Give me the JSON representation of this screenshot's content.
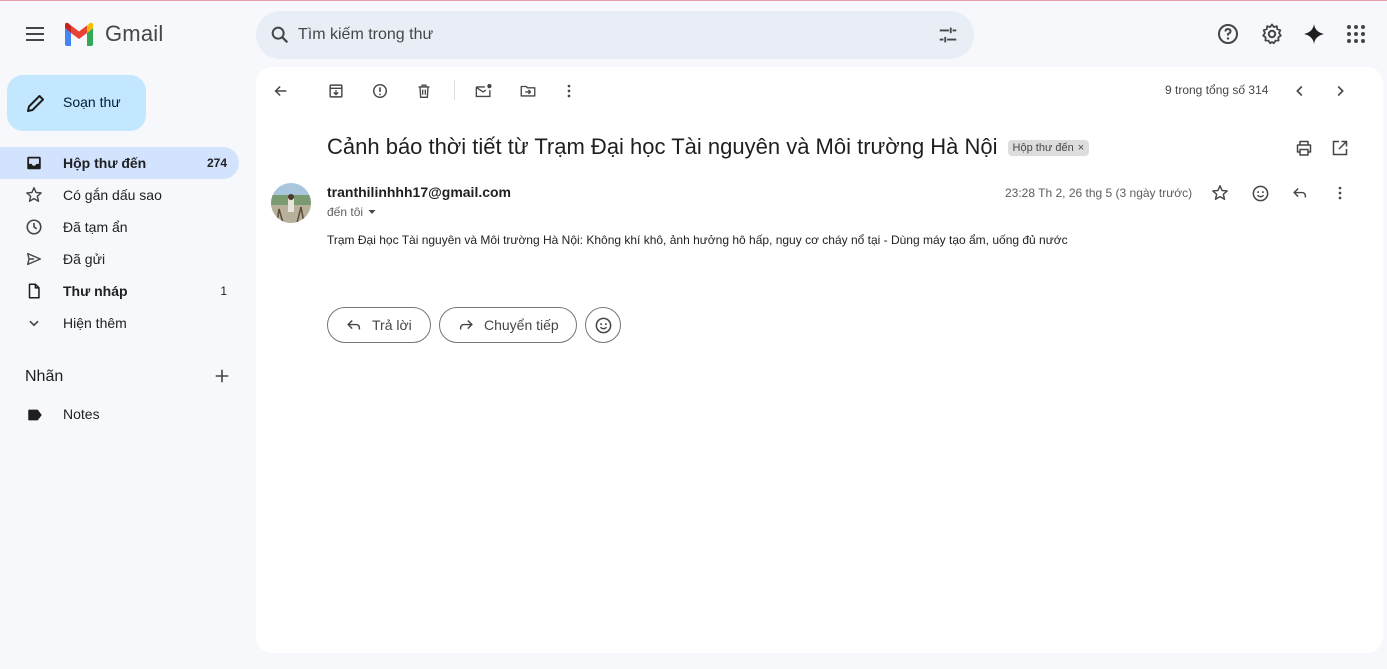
{
  "app": {
    "name": "Gmail"
  },
  "search": {
    "placeholder": "Tìm kiếm trong thư"
  },
  "topbar": {
    "icons": [
      "menu-icon",
      "search-icon",
      "tune-icon",
      "help-icon",
      "gear-icon",
      "sparkle-icon",
      "apps-icon"
    ]
  },
  "sidebar": {
    "compose_label": "Soạn thư",
    "items": [
      {
        "label": "Hộp thư đến",
        "count": "274",
        "icon": "inbox-icon",
        "active": true,
        "bold": true
      },
      {
        "label": "Có gắn dấu sao",
        "count": "",
        "icon": "star-icon",
        "active": false,
        "bold": false
      },
      {
        "label": "Đã tạm ẩn",
        "count": "",
        "icon": "clock-icon",
        "active": false,
        "bold": false
      },
      {
        "label": "Đã gửi",
        "count": "",
        "icon": "send-icon",
        "active": false,
        "bold": false
      },
      {
        "label": "Thư nháp",
        "count": "1",
        "icon": "draft-icon",
        "active": false,
        "bold": true
      },
      {
        "label": "Hiện thêm",
        "count": "",
        "icon": "chevron-down-icon",
        "active": false,
        "bold": false
      }
    ],
    "labels_heading": "Nhãn",
    "labels": [
      {
        "label": "Notes",
        "icon": "label-icon"
      }
    ]
  },
  "toolbar": {
    "pager_text": "9 trong tổng số 314",
    "icons": [
      "back-arrow-icon",
      "archive-icon",
      "report-spam-icon",
      "delete-icon",
      "mark-unread-icon",
      "move-to-icon",
      "more-vert-icon",
      "prev-icon",
      "next-icon"
    ]
  },
  "message": {
    "subject": "Cảnh báo thời tiết từ Trạm Đại học Tài nguyên và Môi trường Hà Nội",
    "label_chip": "Hộp thư đến",
    "chip_close": "×",
    "sender": "tranthilinhhh17@gmail.com",
    "to": "đến tôi",
    "date": "23:28 Th 2, 26 thg 5 (3 ngày trước)",
    "body": "Trạm Đại học Tài nguyên và Môi trường Hà Nội: Không khí khô, ảnh hưởng hô hấp, nguy cơ cháy nổ tại - Dùng máy tạo ẩm, uống đủ nước"
  },
  "actions": {
    "reply": "Trả lời",
    "forward": "Chuyển tiếp"
  },
  "colors": {
    "compose_bg": "#c2e7ff",
    "active_nav": "#d3e3fd",
    "search_bg": "#e9eef6",
    "page_bg": "#f6f8fc"
  }
}
